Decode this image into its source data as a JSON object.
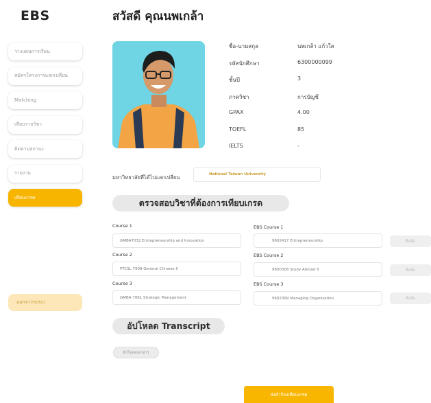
{
  "app": {
    "logo": "EBS"
  },
  "header": {
    "greeting": "สวัสดี คุณนพเกล้า"
  },
  "sidebar": {
    "items": [
      {
        "label": "วางแผนการเรียน"
      },
      {
        "label": "สมัครโครงการแลกเปลี่ยน"
      },
      {
        "label": "Matching"
      },
      {
        "label": "เทียบรายวิชา"
      },
      {
        "label": "ติดตามสถานะ"
      },
      {
        "label": "รายงาน"
      },
      {
        "label": "เทียบเกรด"
      }
    ],
    "active_index": 6,
    "logout": "ออกจากระบบ"
  },
  "profile": {
    "rows": [
      {
        "label": "ชื่อ-นามสกุล",
        "value": "นพเกล้า แก้วใส"
      },
      {
        "label": "รหัสนักศึกษา",
        "value": "6300000099"
      },
      {
        "label": "ชั้นปี",
        "value": "3"
      },
      {
        "label": "ภาควิชา",
        "value": "การบัญชี"
      },
      {
        "label": "GPAX",
        "value": "4.00"
      },
      {
        "label": "TOEFL",
        "value": "85"
      },
      {
        "label": "IELTS",
        "value": "-"
      }
    ]
  },
  "exchange": {
    "university_label": "มหาวิทยาลัยที่ได้ไปแลกเปลี่ยน",
    "university_value": "National Taiwan University"
  },
  "check_section": {
    "title": "ตรวจสอบวิชาที่ต้องการเทียบเกรด",
    "rows": [
      {
        "course_label": "Course 1",
        "course_value": "GMBA7032 Entrepreneurship and Innovation",
        "ebs_label": "EBS Course 1",
        "ebs_value": "9602417 Entrepreneurship",
        "confirm": "ยืนยัน"
      },
      {
        "course_label": "Course 2",
        "course_value": "PTCSL 7909 General Chinese II",
        "ebs_label": "EBS Course 2",
        "ebs_value": "9600308 Study Abroad II",
        "confirm": "ยืนยัน"
      },
      {
        "course_label": "Course 3",
        "course_value": "GMBA 7061 Strategic Management",
        "ebs_label": "EBS Course 3",
        "ebs_value": "9602399 Managing Organization",
        "confirm": "ยืนยัน"
      }
    ]
  },
  "upload_section": {
    "title": "อัปโหลด Transcript",
    "button": "อัปโหลดเอกสาร"
  },
  "submit_button": "ส่งคำร้องเทียบเกรด",
  "colors": {
    "accent": "#f7b500",
    "logout_bg": "#fde7b8",
    "photo_bg": "#6fd4e4"
  }
}
